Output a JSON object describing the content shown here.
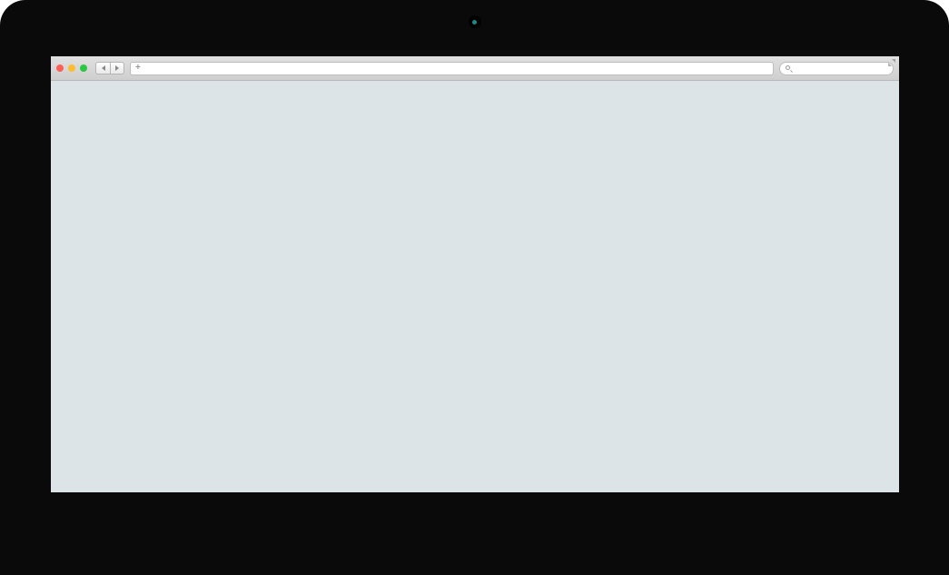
{
  "device": {
    "type": "desktop-monitor"
  },
  "browser": {
    "window_controls": {
      "close": "close",
      "minimize": "minimize",
      "maximize": "maximize"
    },
    "nav": {
      "back": "back",
      "forward": "forward"
    },
    "address_bar": {
      "value": "",
      "add_label": "+"
    },
    "search_bar": {
      "value": "",
      "placeholder": ""
    },
    "fullscreen": "fullscreen"
  },
  "page": {
    "content": ""
  },
  "colors": {
    "bezel": "#0a0a0a",
    "screen_bg": "#dde4e8",
    "chrome_bg": "#d6d6d6",
    "close": "#ff5f57",
    "minimize": "#ffbd2e",
    "maximize": "#28c940"
  }
}
